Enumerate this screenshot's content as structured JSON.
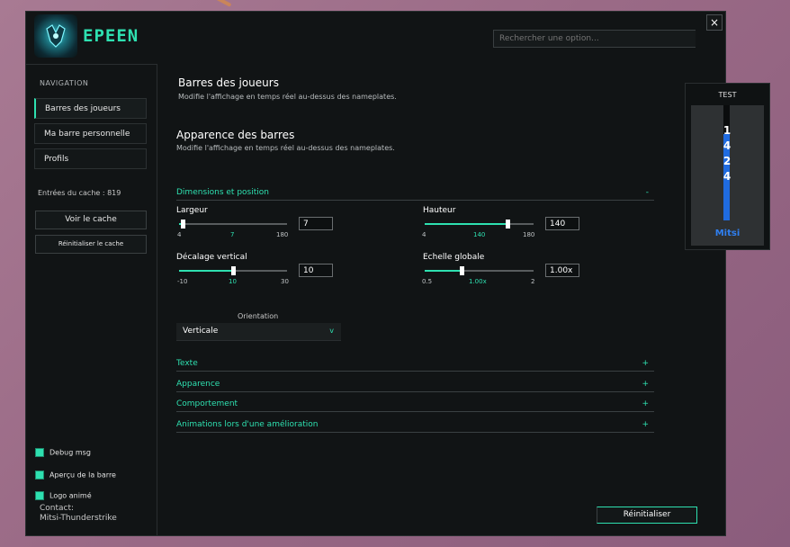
{
  "app": {
    "title": "EPEEN",
    "search_placeholder": "Rechercher une option...",
    "close_glyph": "×"
  },
  "sidebar": {
    "nav_header": "NAVIGATION",
    "items": [
      {
        "label": "Barres des joueurs",
        "active": true
      },
      {
        "label": "Ma barre personnelle",
        "active": false
      },
      {
        "label": "Profils",
        "active": false
      }
    ],
    "cache_text": "Entrées du cache : 819",
    "view_cache": "Voir le cache",
    "reset_cache": "Réinitialiser le cache",
    "checkboxes": [
      {
        "label": "Debug msg",
        "checked": true
      },
      {
        "label": "Aperçu de la barre",
        "checked": true
      },
      {
        "label": "Logo animé",
        "checked": true
      }
    ],
    "contact_label": "Contact:",
    "contact_value": "Mitsi-Thunderstrike"
  },
  "main": {
    "page_title": "Barres des joueurs",
    "page_subtitle": "Modifie l'affichage en temps réel au-dessus des nameplates.",
    "section_title": "Apparence des barres",
    "section_subtitle": "Modifie l'affichage en temps réel au-dessus des nameplates.",
    "dims": {
      "title": "Dimensions et position",
      "sign": "-"
    },
    "sliders": {
      "largeur": {
        "label": "Largeur",
        "min": 4,
        "max": 180,
        "value": 7,
        "min_text": "4",
        "max_text": "180",
        "cur_text": "7",
        "box": "7"
      },
      "hauteur": {
        "label": "Hauteur",
        "min": 4,
        "max": 180,
        "value": 140,
        "min_text": "4",
        "max_text": "180",
        "cur_text": "140",
        "box": "140"
      },
      "decalage": {
        "label": "Décalage vertical",
        "min": -10,
        "max": 30,
        "value": 10,
        "min_text": "-10",
        "max_text": "30",
        "cur_text": "10",
        "box": "10"
      },
      "echelle": {
        "label": "Echelle globale",
        "min": 0.5,
        "max": 2,
        "value": 1.0,
        "min_text": "0.5",
        "max_text": "2",
        "cur_text": "1.00x",
        "box": "1.00x"
      }
    },
    "orientation": {
      "label": "Orientation",
      "value": "Verticale",
      "chevron": "v"
    },
    "collapsed": [
      {
        "title": "Texte",
        "sign": "+"
      },
      {
        "title": "Apparence",
        "sign": "+"
      },
      {
        "title": "Comportement",
        "sign": "+"
      },
      {
        "title": "Animations lors d'une amélioration",
        "sign": "+"
      }
    ],
    "reset_button": "Réinitialiser"
  },
  "preview": {
    "title": "TEST",
    "digits": [
      "1",
      "4",
      "2",
      "4"
    ],
    "name": "Mitsi",
    "fill_fraction": 0.75,
    "fill_color": "#1f6be0"
  },
  "colors": {
    "accent": "#2ee0b0",
    "preview_blue": "#2f7ff0"
  }
}
